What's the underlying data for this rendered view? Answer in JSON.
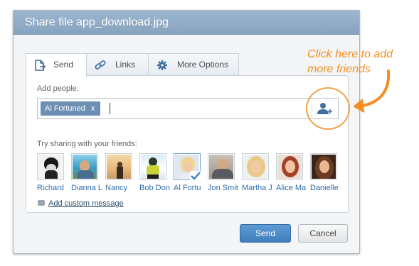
{
  "dialog": {
    "title": "Share file app_download.jpg",
    "tabs": [
      {
        "label": "Send",
        "icon": "document-send-icon"
      },
      {
        "label": "Links",
        "icon": "link-icon"
      },
      {
        "label": "More Options",
        "icon": "gear-icon"
      }
    ],
    "add_people_label": "Add people:",
    "recipients": [
      {
        "label": "Al Fortuned",
        "remove": "x"
      }
    ],
    "try_label": "Try sharing with your friends:",
    "friends": [
      {
        "name": "Richard",
        "selected": false
      },
      {
        "name": "Dianna L",
        "selected": false
      },
      {
        "name": "Nancy",
        "selected": false
      },
      {
        "name": "Bob Don",
        "selected": false
      },
      {
        "name": "Al Fortu",
        "selected": true
      },
      {
        "name": "Jon Smit",
        "selected": false
      },
      {
        "name": "Martha J",
        "selected": false
      },
      {
        "name": "Alice Ma",
        "selected": false
      },
      {
        "name": "Danielle",
        "selected": false
      }
    ],
    "custom_message": "Add custom message",
    "send_label": "Send",
    "cancel_label": "Cancel"
  },
  "callout": {
    "line1": "Click here to add",
    "line2": "more friends"
  },
  "colors": {
    "titlebar": "#8eaac5",
    "accent": "#f28e22",
    "chip": "#6d8fb4",
    "send_button": "#4a88c7",
    "link": "#2f6ea8"
  }
}
